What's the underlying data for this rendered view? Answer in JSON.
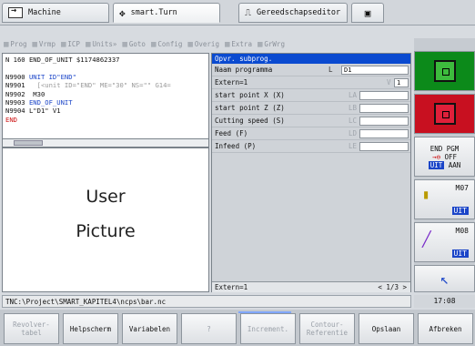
{
  "tabs": [
    {
      "label": "Machine",
      "icon": "machine-arrow-icon",
      "active": false
    },
    {
      "label": "smart.Turn",
      "icon": "smart-turn-icon",
      "active": true
    },
    {
      "label": "Gereedschapseditor",
      "icon": "tool-editor-icon",
      "active": false
    },
    {
      "label": "",
      "icon": "save-icon",
      "active": false
    }
  ],
  "menu": [
    "Prog",
    "Vrmp",
    "ICP",
    "Units»",
    "Goto",
    "Config",
    "Overig",
    "Extra",
    "GrWrg"
  ],
  "code_lines": [
    {
      "num": "N 160",
      "text": "END_OF_UNIT $1174862337",
      "cls": ""
    },
    {
      "num": "",
      "text": "",
      "cls": ""
    },
    {
      "num": "N9900",
      "text": "UNIT ID\"END\"",
      "cls": "blue"
    },
    {
      "num": "N9901",
      "text": "[<unit ID=\"END\" ME=\"30\" NS=\"\" G14=",
      "cls": "grey"
    },
    {
      "num": "N9902",
      "text": "M30",
      "cls": ""
    },
    {
      "num": "N9903",
      "text": "END_OF_UNIT",
      "cls": "blue"
    },
    {
      "num": "N9904",
      "text": "L\"D1\" V1",
      "cls": ""
    },
    {
      "num": "",
      "text": "END",
      "cls": "red"
    }
  ],
  "user_picture": {
    "line1": "User",
    "line2": "Picture"
  },
  "form": {
    "title": "Opvr. subprog.",
    "rows": [
      {
        "label": "Naam programma",
        "addr": "L",
        "value": "D1"
      },
      {
        "label": "Extern=1",
        "addr": "V",
        "value": "1"
      },
      {
        "label": "start point X (X)",
        "addr": "LA",
        "value": ""
      },
      {
        "label": "start point Z (Z)",
        "addr": "LB",
        "value": ""
      },
      {
        "label": "Cutting speed (S)",
        "addr": "LC",
        "value": ""
      },
      {
        "label": "Feed (F)",
        "addr": "LD",
        "value": ""
      },
      {
        "label": "Infeed (P)",
        "addr": "LE",
        "value": ""
      }
    ],
    "footer_text": "Extern=1",
    "page": "< 1/3 >"
  },
  "side": {
    "end_pgm": "END PGM",
    "off": "OFF",
    "uit": "UIT",
    "aan": "AAN",
    "m07": "M07",
    "m08": "M08"
  },
  "status": {
    "path": "TNC:\\Project\\SMART_KAPITEL4\\ncps\\bar.nc",
    "time": "17:08"
  },
  "softkeys": [
    {
      "label": "Revolver-\ntabel",
      "disabled": true
    },
    {
      "label": "Helpscherm",
      "disabled": false
    },
    {
      "label": "Variabelen",
      "disabled": false
    },
    {
      "label": "?",
      "disabled": true
    },
    {
      "label": "Increment.",
      "disabled": true
    },
    {
      "label": "Contour-\nReferentie",
      "disabled": true
    },
    {
      "label": "Opslaan",
      "disabled": false
    },
    {
      "label": "Afbreken",
      "disabled": false
    }
  ]
}
